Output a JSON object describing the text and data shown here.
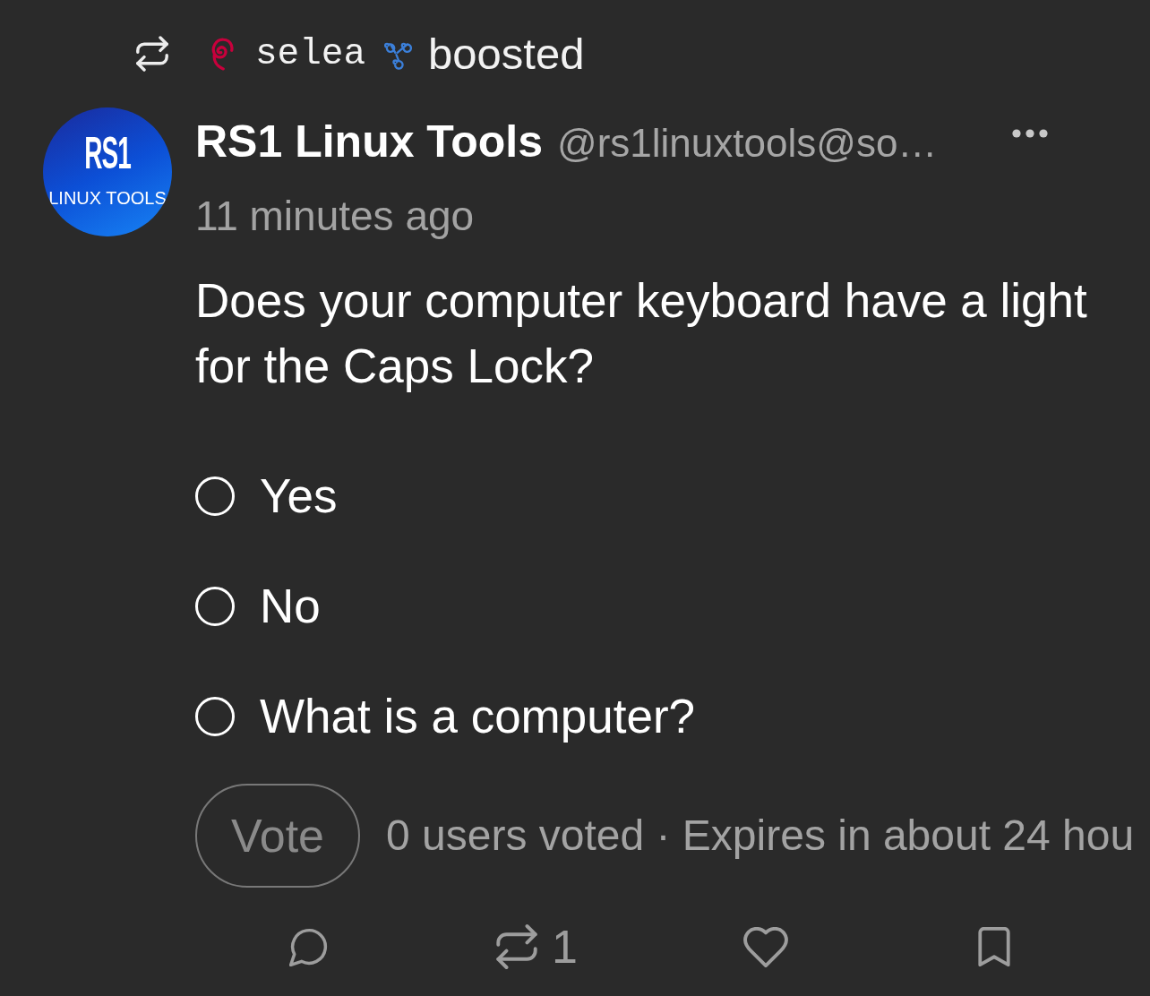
{
  "boost_banner": {
    "booster_name": "selea",
    "action": "boosted"
  },
  "post": {
    "author": {
      "display_name": "RS1 Linux Tools",
      "handle": "@rs1linuxtools@so…",
      "avatar": {
        "title": "RS1",
        "subtitle": "LINUX TOOLS"
      }
    },
    "timestamp": "11 minutes ago",
    "content": "Does your computer keyboard have a light for the Caps Lock?"
  },
  "poll": {
    "options": [
      {
        "label": "Yes",
        "selected": false
      },
      {
        "label": "No",
        "selected": false
      },
      {
        "label": "What is a computer?",
        "selected": false
      }
    ],
    "vote_button": {
      "label": "Vote",
      "disabled": true
    },
    "summary": "0 users voted · Expires in about 24 hou"
  },
  "actions": [
    {
      "kind": "reply"
    },
    {
      "kind": "boost",
      "count": "1"
    },
    {
      "kind": "favourite"
    },
    {
      "kind": "bookmark"
    }
  ]
}
